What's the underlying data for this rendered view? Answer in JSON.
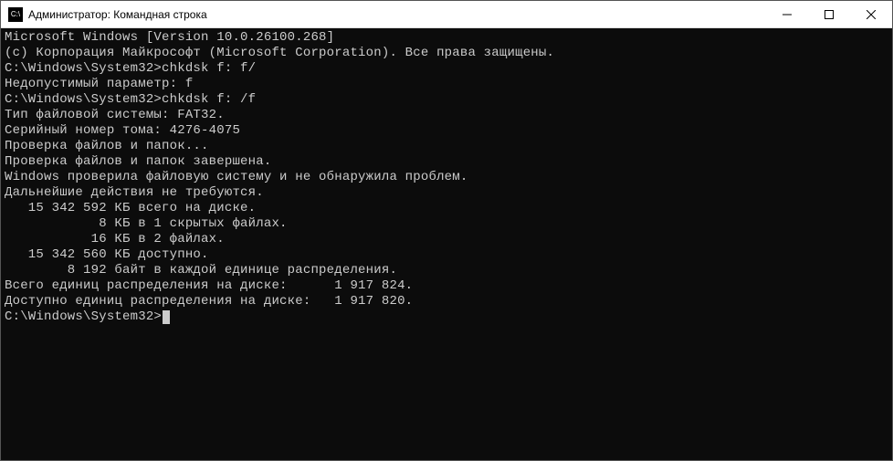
{
  "window": {
    "icon_label": "C:\\",
    "title": "Администратор: Командная строка"
  },
  "lines": [
    "Microsoft Windows [Version 10.0.26100.268]",
    "(c) Корпорация Майкрософт (Microsoft Corporation). Все права защищены.",
    "",
    "C:\\Windows\\System32>chkdsk f: f/",
    "Недопустимый параметр: f",
    "",
    "C:\\Windows\\System32>chkdsk f: /f",
    "Тип файловой системы: FAT32.",
    "Серийный номер тома: 4276-4075",
    "Проверка файлов и папок...",
    "Проверка файлов и папок завершена.",
    "",
    "Windows проверила файловую систему и не обнаружила проблем.",
    "Дальнейшие действия не требуются.",
    "   15 342 592 КБ всего на диске.",
    "            8 КБ в 1 скрытых файлах.",
    "           16 КБ в 2 файлах.",
    "   15 342 560 КБ доступно.",
    "",
    "        8 192 байт в каждой единице распределения.",
    "Всего единиц распределения на диске:      1 917 824.",
    "Доступно единиц распределения на диске:   1 917 820.",
    "",
    "C:\\Windows\\System32>"
  ]
}
